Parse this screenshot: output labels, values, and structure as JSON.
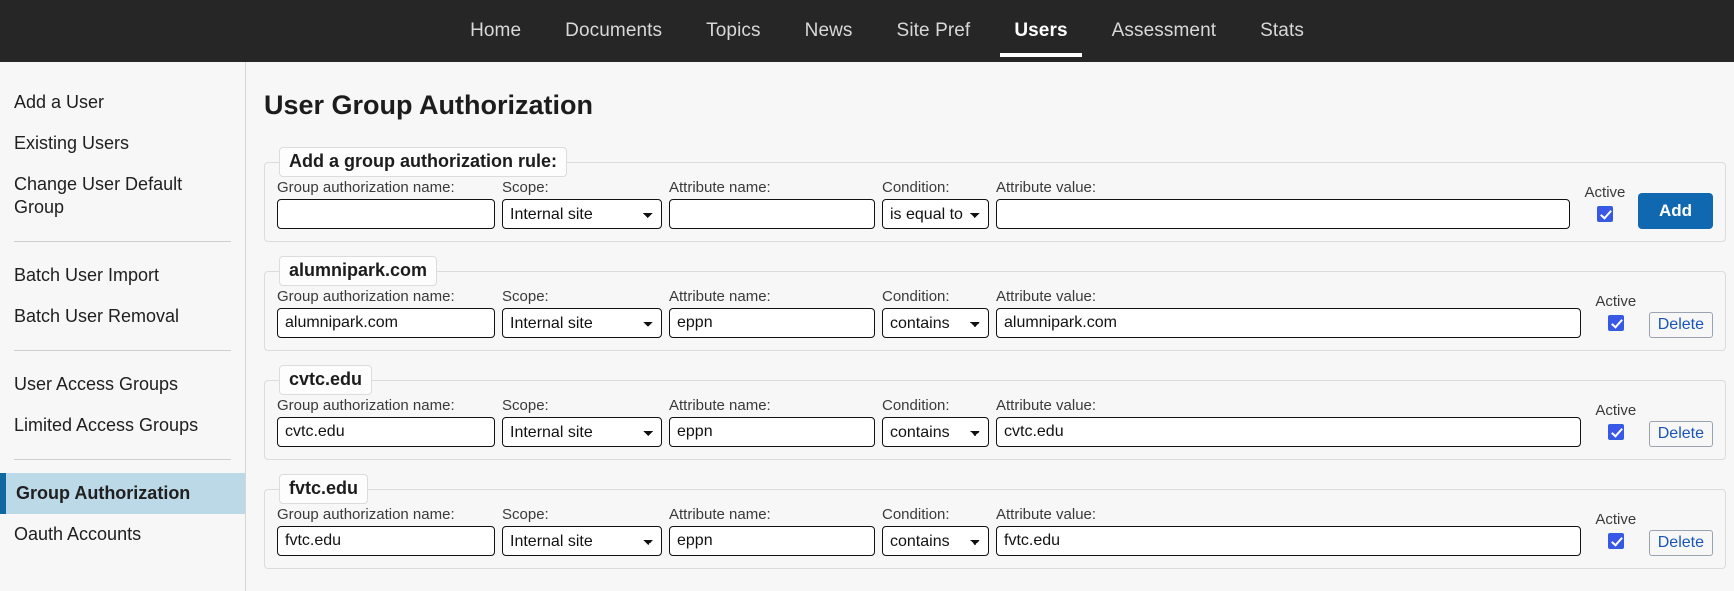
{
  "nav": {
    "items": [
      {
        "label": "Home",
        "active": false
      },
      {
        "label": "Documents",
        "active": false
      },
      {
        "label": "Topics",
        "active": false
      },
      {
        "label": "News",
        "active": false
      },
      {
        "label": "Site Pref",
        "active": false
      },
      {
        "label": "Users",
        "active": true
      },
      {
        "label": "Assessment",
        "active": false
      },
      {
        "label": "Stats",
        "active": false
      }
    ]
  },
  "sidebar": {
    "items": [
      {
        "label": "Add a User"
      },
      {
        "label": "Existing Users"
      },
      {
        "label": "Change User Default Group"
      },
      {
        "label": "Batch User Import"
      },
      {
        "label": "Batch User Removal"
      },
      {
        "label": "User Access Groups"
      },
      {
        "label": "Limited Access Groups"
      },
      {
        "label": "Group Authorization"
      },
      {
        "label": "Oauth Accounts"
      }
    ]
  },
  "main": {
    "title": "User Group Authorization",
    "labels": {
      "name": "Group authorization name:",
      "scope": "Scope:",
      "attribute_name": "Attribute name:",
      "condition": "Condition:",
      "attribute_value": "Attribute value:",
      "active": "Active"
    },
    "buttons": {
      "add": "Add",
      "delete": "Delete"
    },
    "add_form": {
      "legend": "Add a group authorization rule:",
      "name": "",
      "scope": "Internal site",
      "attribute_name": "",
      "condition": "is equal to",
      "attribute_value": "",
      "active": true
    },
    "rules": [
      {
        "legend": "alumnipark.com",
        "name": "alumnipark.com",
        "scope": "Internal site",
        "attribute_name": "eppn",
        "condition": "contains",
        "attribute_value": "alumnipark.com",
        "active": true
      },
      {
        "legend": "cvtc.edu",
        "name": "cvtc.edu",
        "scope": "Internal site",
        "attribute_name": "eppn",
        "condition": "contains",
        "attribute_value": "cvtc.edu",
        "active": true
      },
      {
        "legend": "fvtc.edu",
        "name": "fvtc.edu",
        "scope": "Internal site",
        "attribute_name": "eppn",
        "condition": "contains",
        "attribute_value": "fvtc.edu",
        "active": true
      }
    ]
  }
}
